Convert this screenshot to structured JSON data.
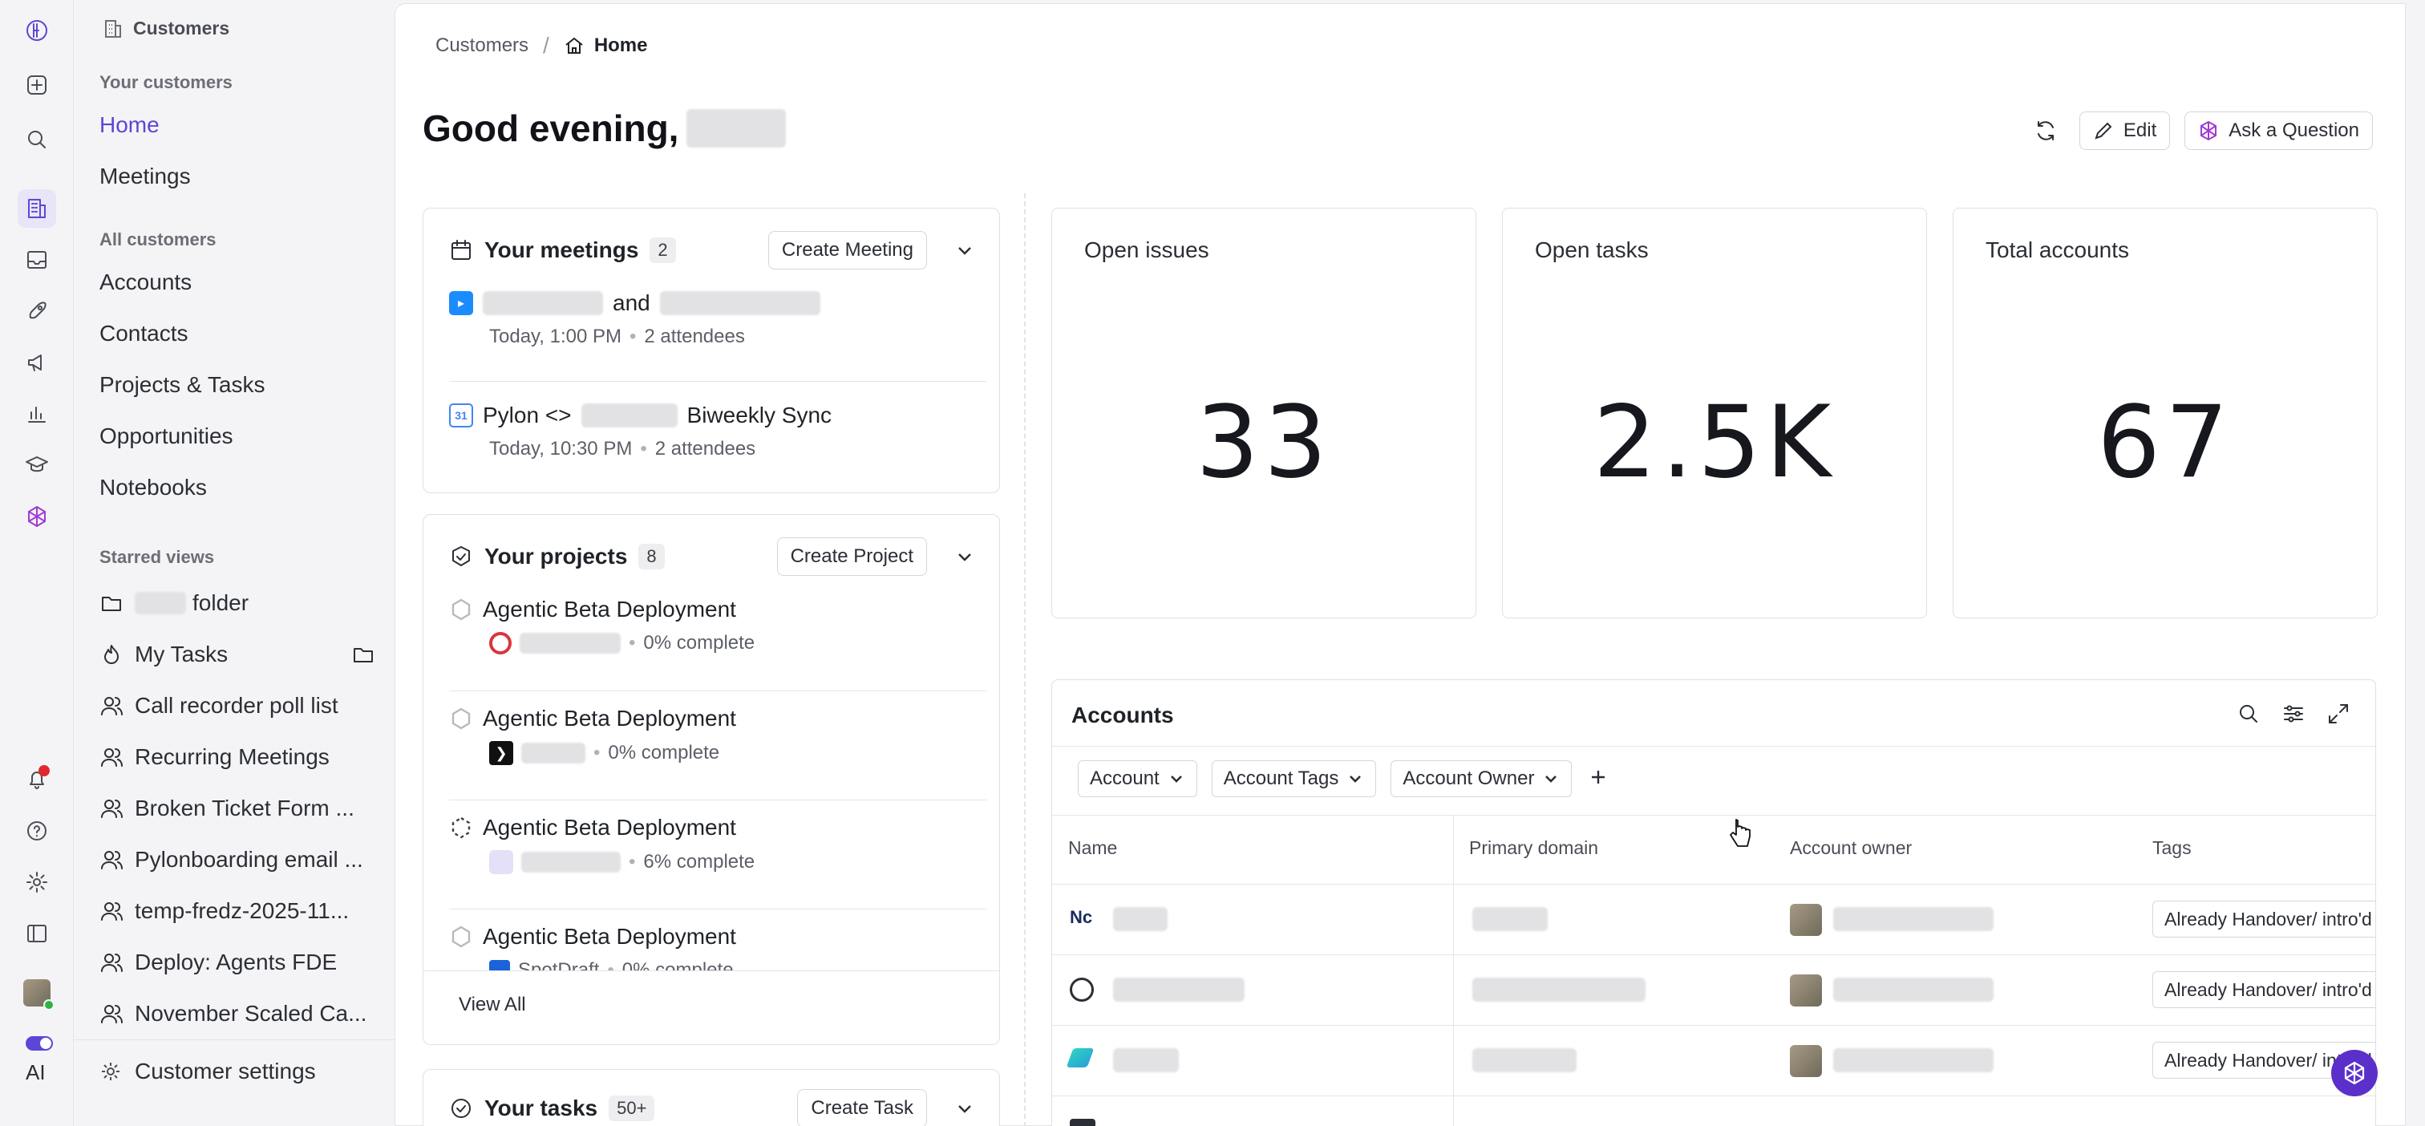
{
  "breadcrumb": {
    "root": "Customers",
    "current": "Home"
  },
  "greeting": "Good evening,",
  "actions": {
    "edit": "Edit",
    "ask": "Ask a Question"
  },
  "sidebar": {
    "header": "Customers",
    "section_your": "Your customers",
    "home": "Home",
    "meetings": "Meetings",
    "section_all": "All customers",
    "accounts": "Accounts",
    "contacts": "Contacts",
    "projects_tasks": "Projects & Tasks",
    "opportunities": "Opportunities",
    "notebooks": "Notebooks",
    "section_starred": "Starred views",
    "starred": [
      {
        "label": "folder"
      },
      {
        "label": "My Tasks"
      },
      {
        "label": "Call recorder poll list"
      },
      {
        "label": "Recurring Meetings"
      },
      {
        "label": "Broken Ticket Form ..."
      },
      {
        "label": "Pylonboarding email ..."
      },
      {
        "label": "temp-fredz-2025-11..."
      },
      {
        "label": "Deploy: Agents FDE"
      },
      {
        "label": "November Scaled Ca..."
      }
    ],
    "settings": "Customer settings",
    "ai_label": "AI"
  },
  "meetings": {
    "title": "Your meetings",
    "count": "2",
    "create": "Create Meeting",
    "items": [
      {
        "title_mid": "and",
        "time": "Today, 1:00 PM",
        "attendees": "2 attendees"
      },
      {
        "title_pre": "Pylon <>",
        "title_post": "Biweekly Sync",
        "time": "Today, 10:30 PM",
        "attendees": "2 attendees"
      }
    ]
  },
  "projects": {
    "title": "Your projects",
    "count": "8",
    "create": "Create Project",
    "items": [
      {
        "name": "Agentic Beta Deployment",
        "progress": "0% complete"
      },
      {
        "name": "Agentic Beta Deployment",
        "progress": "0% complete"
      },
      {
        "name": "Agentic Beta Deployment",
        "progress": "6% complete"
      },
      {
        "name": "Agentic Beta Deployment",
        "account": "SpotDraft",
        "progress": "0% complete"
      }
    ],
    "view_all": "View All"
  },
  "tasks": {
    "title": "Your tasks",
    "count": "50+",
    "create": "Create Task"
  },
  "stats": [
    {
      "label": "Open issues",
      "value": "33"
    },
    {
      "label": "Open tasks",
      "value": "2.5K"
    },
    {
      "label": "Total accounts",
      "value": "67"
    }
  ],
  "accounts": {
    "title": "Accounts",
    "filters": [
      "Account",
      "Account Tags",
      "Account Owner"
    ],
    "columns": [
      "Name",
      "Primary domain",
      "Account owner",
      "Tags"
    ],
    "tag_value": "Already Handover/ intro'd"
  }
}
